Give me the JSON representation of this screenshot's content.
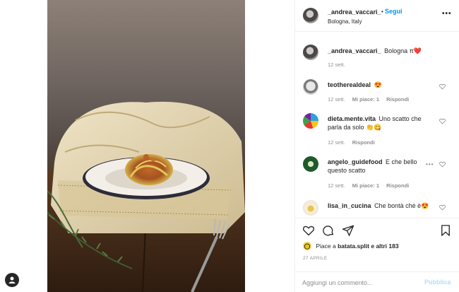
{
  "post": {
    "author": "_andrea_vaccari_",
    "follow_separator": "•",
    "follow_label": "Segui",
    "location": "Bologna, Italy",
    "more_label": "•••",
    "caption": {
      "username": "_andrea_vaccari_",
      "text": "Bologna",
      "emoji": "π❤️",
      "time": "12 sett."
    }
  },
  "comments": [
    {
      "username": "teotherealdeal",
      "text": "😍",
      "time": "12 sett.",
      "likes": "Mi piace: 1",
      "reply": "Rispondi"
    },
    {
      "username": "dieta.mente.vita",
      "text": "Uno scatto che parla da solo 👏😋",
      "time": "12 sett.",
      "likes": "",
      "reply": "Rispondi"
    },
    {
      "username": "angelo_guidefood",
      "text": "E che bello questo scatto",
      "time": "12 sett.",
      "likes": "Mi piace: 1",
      "reply": "Rispondi",
      "more": "•••"
    },
    {
      "username": "lisa_in_cucina",
      "text": "Che bontà ché è😍"
    }
  ],
  "actions": {
    "liked_by_prefix": "Piace a",
    "liked_by_user": "batata.split",
    "liked_by_suffix": "e altri 183",
    "date": "27 APRILE",
    "comment_placeholder": "Aggiungi un commento...",
    "publish_label": "Pubblica"
  },
  "colors": {
    "accent": "#0095f6",
    "publish_disabled": "#b2dffc",
    "muted": "#8e8e8e",
    "text": "#262626"
  }
}
